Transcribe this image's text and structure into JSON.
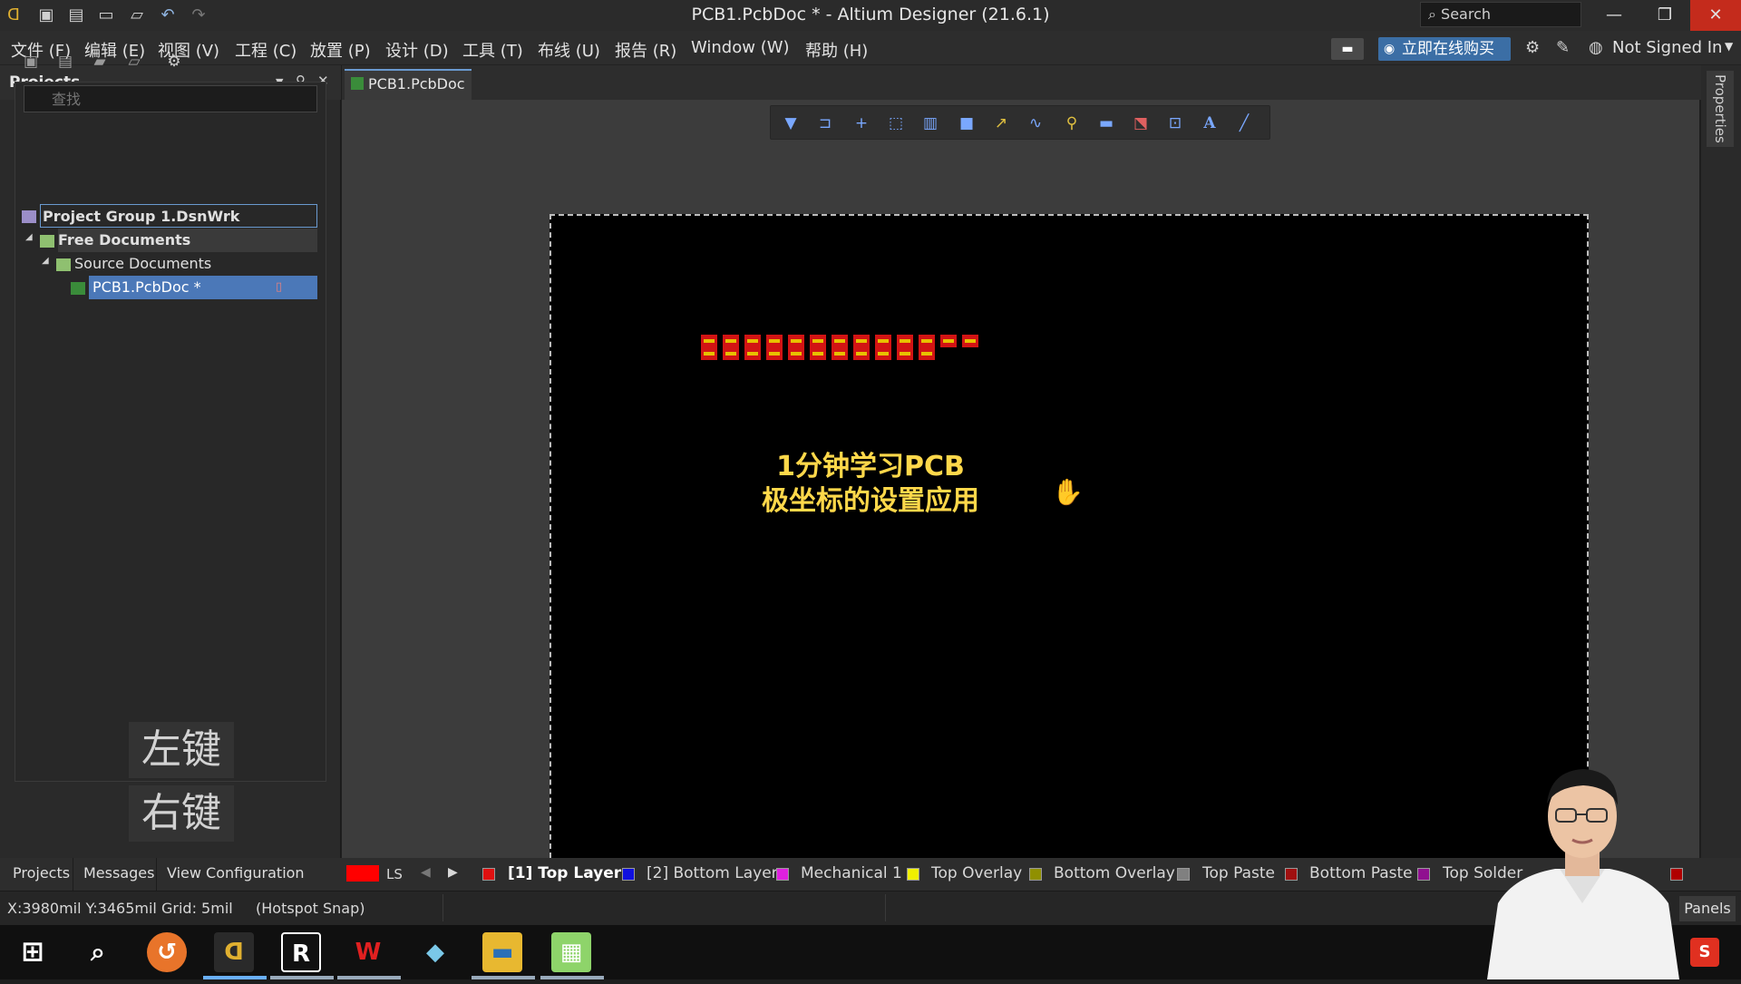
{
  "titlebar": {
    "title": "PCB1.PcbDoc * - Altium Designer (21.6.1)",
    "search_label": "Search"
  },
  "menu": {
    "items": [
      "文件 (F)",
      "编辑 (E)",
      "视图 (V)",
      "工程 (C)",
      "放置 (P)",
      "设计 (D)",
      "工具 (T)",
      "布线 (U)",
      "报告 (R)",
      "Window (W)",
      "帮助 (H)"
    ],
    "buy_label": "立即在线购买",
    "user_label": "Not Signed In"
  },
  "projects": {
    "title": "Projects",
    "search_placeholder": "查找",
    "tree": {
      "group": "Project Group 1.DsnWrk",
      "free_docs": "Free Documents",
      "source_docs": "Source Documents",
      "pcb_doc": "PCB1.PcbDoc *"
    }
  },
  "doc_tab": {
    "label": "PCB1.PcbDoc *"
  },
  "canvas": {
    "overlay_line1": "1分钟学习PCB",
    "overlay_line2": "极坐标的设置应用"
  },
  "properties_label": "Properties",
  "keys": {
    "left": "左键",
    "right": "右键"
  },
  "bottom_tabs": [
    "Projects",
    "Messages",
    "View Configuration"
  ],
  "layer_bar": {
    "ls_label": "LS",
    "layers": [
      {
        "label": "[1] Top Layer",
        "color": "#e01010"
      },
      {
        "label": "[2] Bottom Layer",
        "color": "#1010e0"
      },
      {
        "label": "Mechanical 1",
        "color": "#e020e0"
      },
      {
        "label": "Top Overlay",
        "color": "#f0f000"
      },
      {
        "label": "Bottom Overlay",
        "color": "#909000"
      },
      {
        "label": "Top Paste",
        "color": "#808080"
      },
      {
        "label": "Bottom Paste",
        "color": "#a01010"
      },
      {
        "label": "Top Solder",
        "color": "#901090"
      }
    ]
  },
  "status": {
    "coords": "X:3980mil Y:3465mil",
    "grid": "Grid: 5mil",
    "snap": "(Hotspot Snap)",
    "panels_label": "Panels"
  },
  "colors": {
    "accent": "#3b6ea5",
    "board_bg": "#000000",
    "overlay_text": "#ffd84a",
    "pad_red": "#d21414"
  }
}
